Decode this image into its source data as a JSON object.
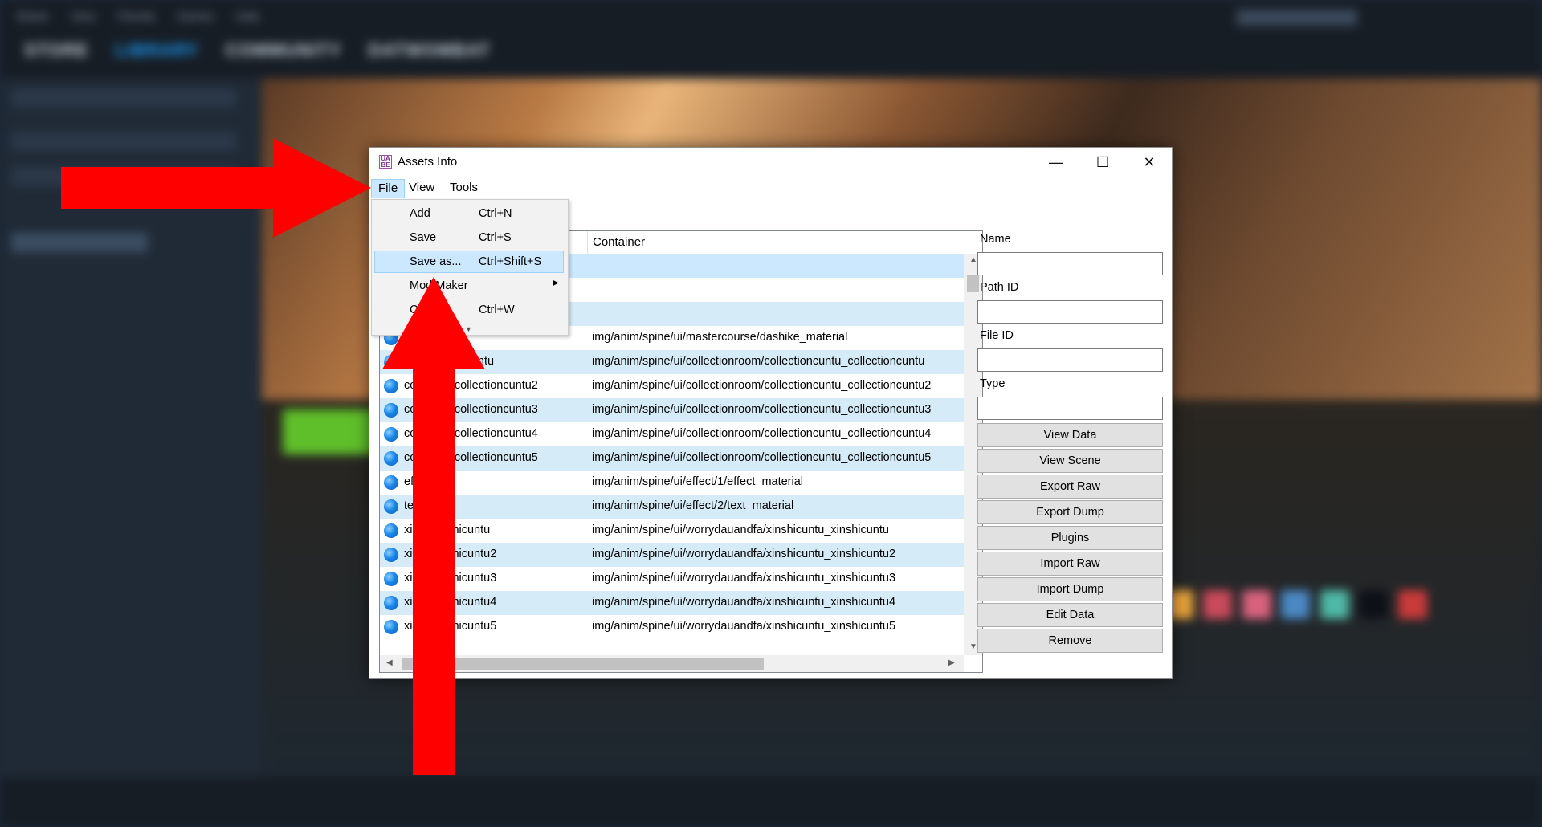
{
  "steam": {
    "menu": [
      "Steam",
      "View",
      "Friends",
      "Games",
      "Help"
    ],
    "nav": [
      "STORE",
      "LIBRARY",
      "COMMUNITY",
      "DATWOMBAT"
    ]
  },
  "window": {
    "title": "Assets Info",
    "minimize_icon": "—",
    "maximize_icon": "☐",
    "close_icon": "✕"
  },
  "menubar": {
    "file": "File",
    "view": "View",
    "tools": "Tools"
  },
  "file_menu": {
    "items": [
      {
        "label": "Add",
        "shortcut": "Ctrl+N"
      },
      {
        "label": "Save",
        "shortcut": "Ctrl+S"
      },
      {
        "label": "Save as...",
        "shortcut": "Ctrl+Shift+S"
      },
      {
        "label": "Mod Maker",
        "shortcut": ""
      },
      {
        "label": "C",
        "shortcut": "Ctrl+W"
      }
    ]
  },
  "table": {
    "container_header": "Container",
    "rows": [
      {
        "name": "",
        "container": ""
      },
      {
        "name": "",
        "container": ""
      },
      {
        "name": "",
        "container": ""
      },
      {
        "name": "erial",
        "container": "img/anim/spine/ui/mastercourse/dashike_material"
      },
      {
        "name": "u_collectioncuntu",
        "container": "img/anim/spine/ui/collectionroom/collectioncuntu_collectioncuntu"
      },
      {
        "name": "co      cuntu_collectioncuntu2",
        "container": "img/anim/spine/ui/collectionroom/collectioncuntu_collectioncuntu2"
      },
      {
        "name": "co      cuntu_collectioncuntu3",
        "container": "img/anim/spine/ui/collectionroom/collectioncuntu_collectioncuntu3"
      },
      {
        "name": "co      cuntu_collectioncuntu4",
        "container": "img/anim/spine/ui/collectionroom/collectioncuntu_collectioncuntu4"
      },
      {
        "name": "co      cuntu_collectioncuntu5",
        "container": "img/anim/spine/ui/collectionroom/collectioncuntu_collectioncuntu5"
      },
      {
        "name": "ef      aterial",
        "container": "img/anim/spine/ui/effect/1/effect_material"
      },
      {
        "name": "te      erial",
        "container": "img/anim/spine/ui/effect/2/text_material"
      },
      {
        "name": "xi      tu_xinshicuntu",
        "container": "img/anim/spine/ui/worrydauandfa/xinshicuntu_xinshicuntu"
      },
      {
        "name": "xi      tu_xinshicuntu2",
        "container": "img/anim/spine/ui/worrydauandfa/xinshicuntu_xinshicuntu2"
      },
      {
        "name": "xi      tu_xinshicuntu3",
        "container": "img/anim/spine/ui/worrydauandfa/xinshicuntu_xinshicuntu3"
      },
      {
        "name": "xi      tu_xinshicuntu4",
        "container": "img/anim/spine/ui/worrydauandfa/xinshicuntu_xinshicuntu4"
      },
      {
        "name": "xi      tu_xinshicuntu5",
        "container": "img/anim/spine/ui/worrydauandfa/xinshicuntu_xinshicuntu5"
      }
    ]
  },
  "panel": {
    "name_label": "Name",
    "path_id_label": "Path ID",
    "file_id_label": "File ID",
    "type_label": "Type",
    "buttons": [
      "View Data",
      "View Scene",
      "Export Raw",
      "Export Dump",
      "Plugins",
      "Import Raw",
      "Import Dump",
      "Edit Data",
      "Remove"
    ]
  },
  "colors": {
    "annotation_arrow": "#ff0000",
    "row_alt": "#d5ebf7",
    "menu_highlight": "#cce8ff"
  }
}
